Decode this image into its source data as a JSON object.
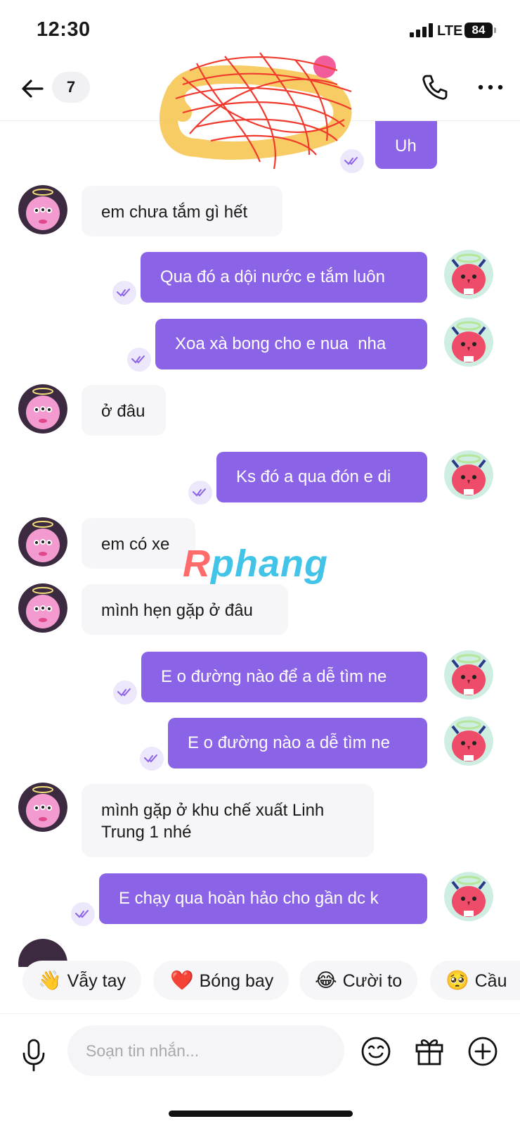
{
  "status": {
    "time": "12:30",
    "network": "LTE",
    "battery": "84"
  },
  "header": {
    "unread_count": "7"
  },
  "messages": [
    {
      "side": "out",
      "text": "Uh"
    },
    {
      "side": "in",
      "text": "em chưa tắm gì hết"
    },
    {
      "side": "out",
      "text": "Qua đó a dội nước e tắm luôn"
    },
    {
      "side": "out",
      "text": "Xoa xà bong cho e nua  nha"
    },
    {
      "side": "in",
      "text": "ở đâu"
    },
    {
      "side": "out",
      "text": "Ks đó a qua đón e di"
    },
    {
      "side": "in",
      "text": "em có xe"
    },
    {
      "side": "in",
      "text": "mình hẹn gặp ở đâu"
    },
    {
      "side": "out",
      "text": "E o đường nào để a dễ tìm ne"
    },
    {
      "side": "out",
      "text": "E o đường nào a dễ tìm ne"
    },
    {
      "side": "in",
      "text": "mình gặp ở khu chế xuất Linh Trung 1 nhé"
    },
    {
      "side": "out",
      "text": "E chạy qua hoàn hảo cho gần dc k"
    }
  ],
  "watermark": {
    "part1": "R",
    "part2": "phang"
  },
  "reactions": [
    {
      "emoji": "👋",
      "label": "Vẫy tay"
    },
    {
      "emoji": "❤️",
      "label": "Bóng bay"
    },
    {
      "emoji": "😂",
      "label": "Cười to"
    },
    {
      "emoji": "🥺",
      "label": "Cầu"
    }
  ],
  "composer": {
    "placeholder": "Soạn tin nhắn..."
  },
  "colors": {
    "accent": "#8b63e6",
    "incoming_bubble": "#f6f6f8"
  }
}
